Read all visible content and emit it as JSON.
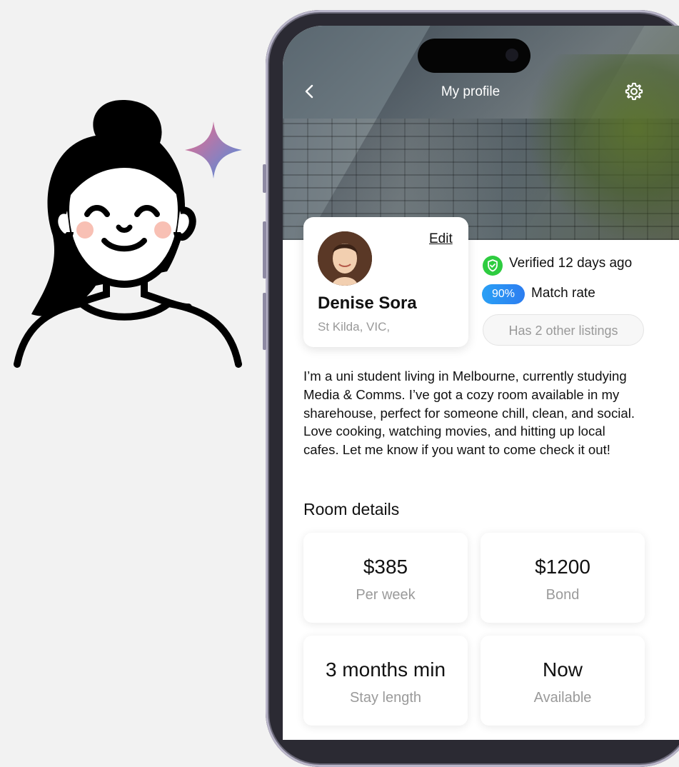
{
  "header": {
    "title": "My profile"
  },
  "profile": {
    "edit_label": "Edit",
    "name": "Denise Sora",
    "location": "St Kilda, VIC,"
  },
  "verification": {
    "text": "Verified 12 days ago"
  },
  "match": {
    "percent": "90%",
    "label": "Match rate"
  },
  "listings": {
    "label": "Has 2 other listings"
  },
  "bio": "I’m a uni student living in Melbourne, currently studying Media & Comms. I’ve got a cozy room available in my sharehouse, perfect for someone chill, clean, and social. Love cooking, watching movies, and hitting up local cafes. Let me know if you want to come check it out!",
  "room_details": {
    "title": "Room details",
    "items": [
      {
        "value": "$385",
        "label": "Per week"
      },
      {
        "value": "$1200",
        "label": "Bond"
      },
      {
        "value": "3 months min",
        "label": "Stay length"
      },
      {
        "value": "Now",
        "label": "Available"
      }
    ]
  },
  "colors": {
    "match_gradient_start": "#2aa0f5",
    "match_gradient_end": "#2c7df0",
    "verified_green": "#2ecc40"
  },
  "icons": [
    "back-chevron-icon",
    "gear-icon",
    "verified-shield-icon",
    "sparkle-icon"
  ]
}
